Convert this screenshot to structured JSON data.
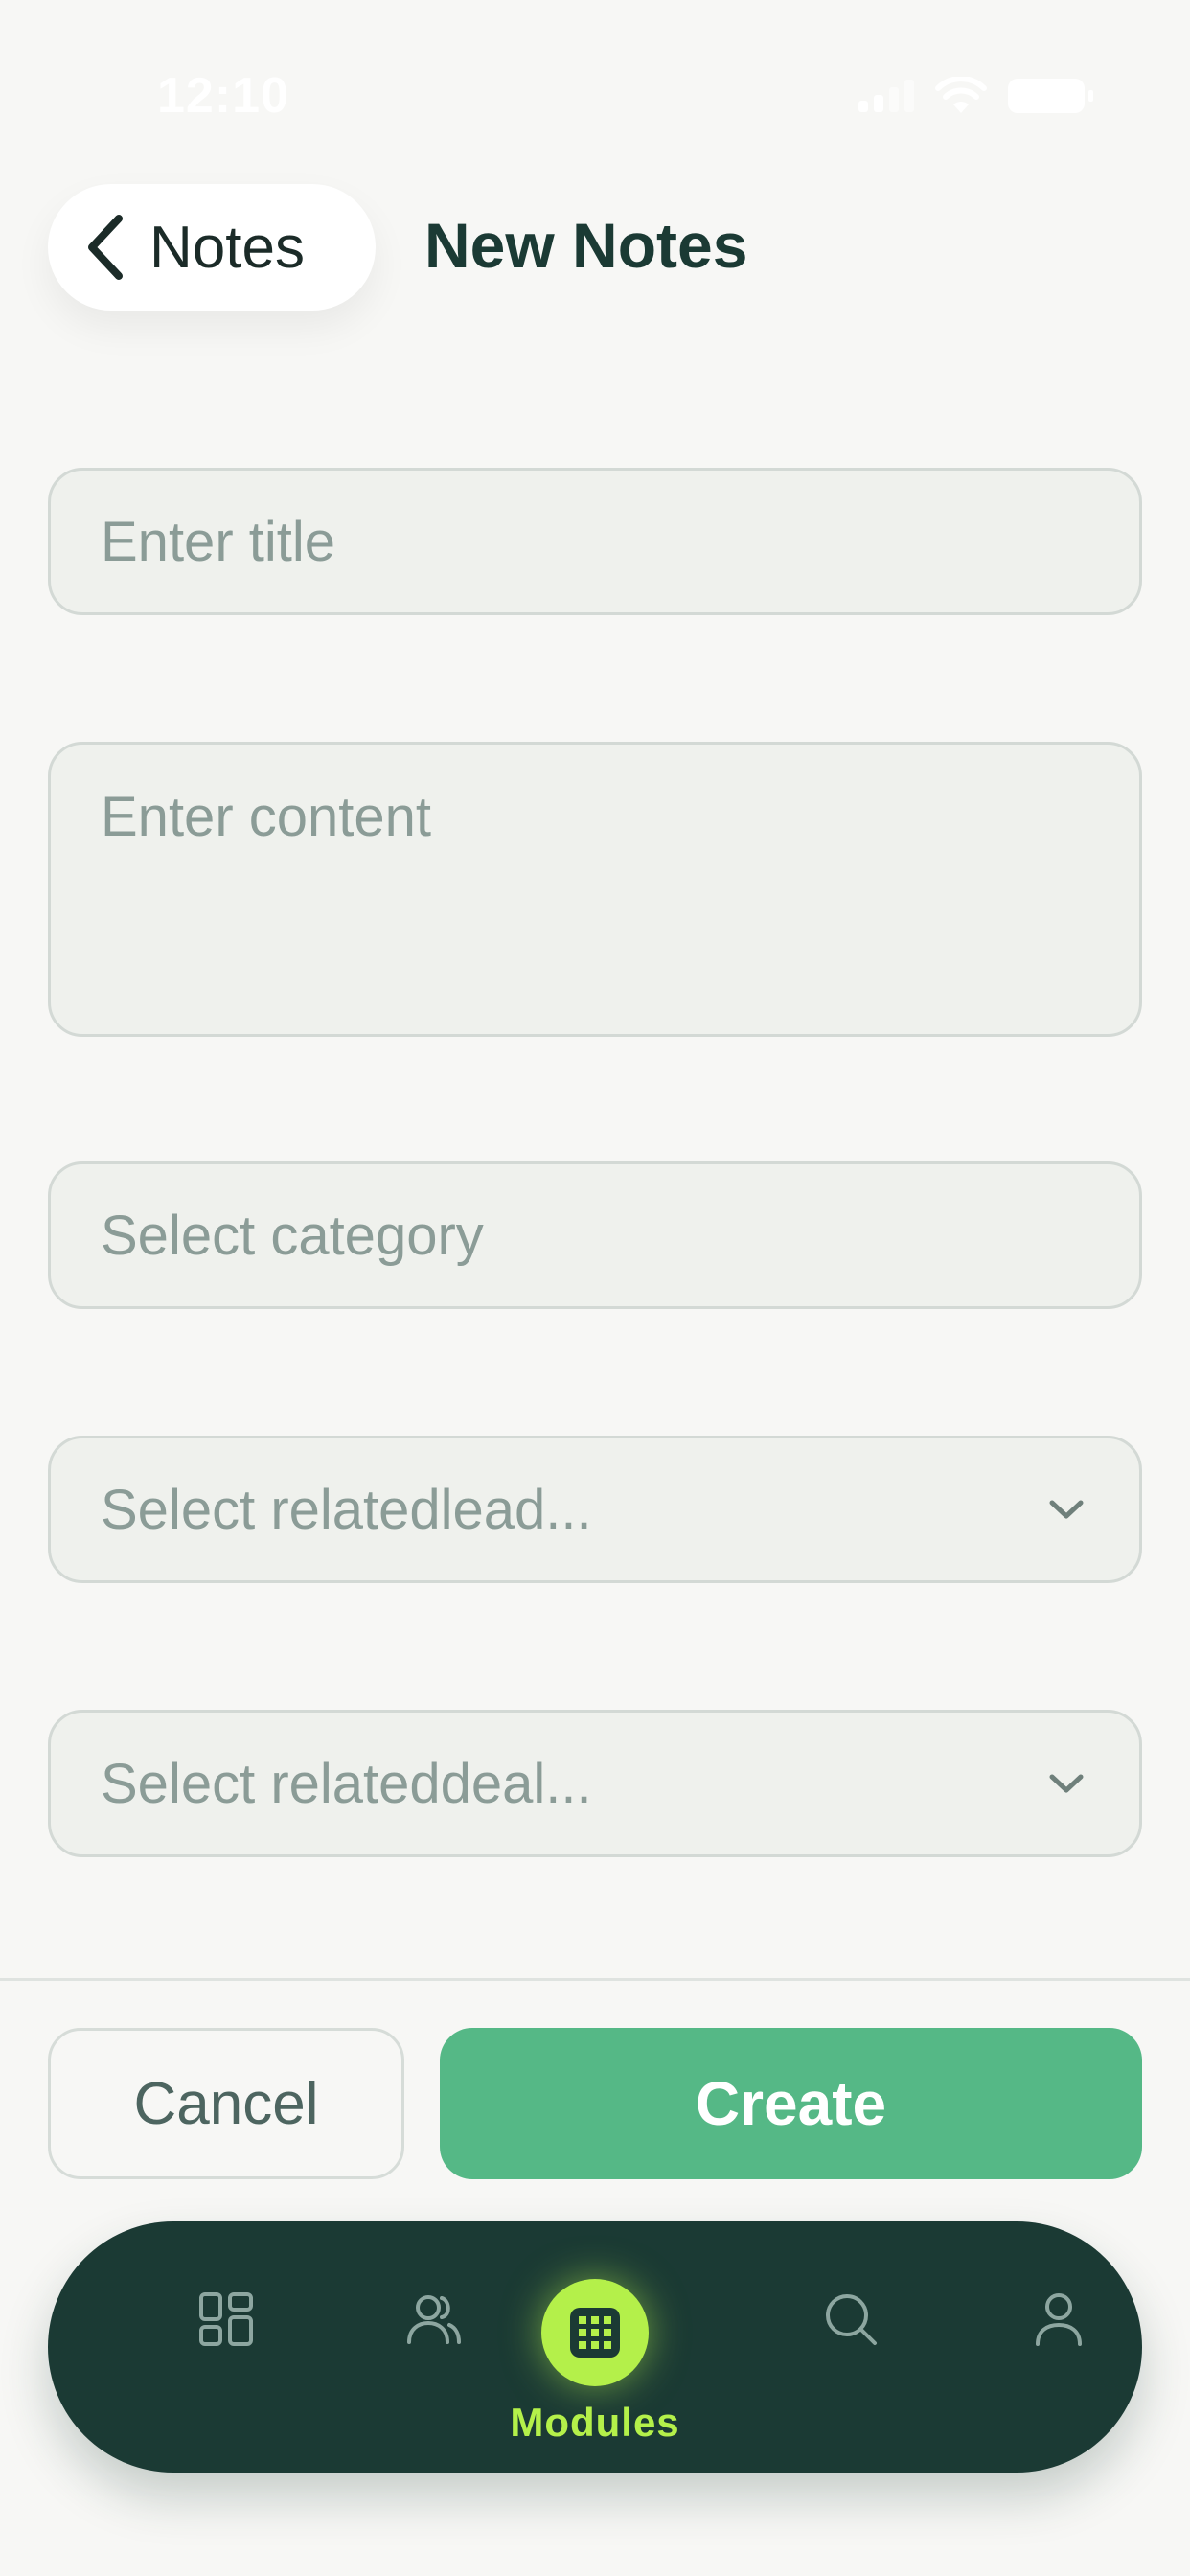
{
  "status_bar": {
    "time": "12:10"
  },
  "header": {
    "back_label": "Notes",
    "title": "New Notes"
  },
  "form": {
    "title_placeholder": "Enter title",
    "content_placeholder": "Enter content",
    "category_placeholder": "Select category",
    "related_lead_placeholder": "Select relatedlead...",
    "related_deal_placeholder": "Select relateddeal..."
  },
  "actions": {
    "cancel_label": "Cancel",
    "create_label": "Create"
  },
  "tab_bar": {
    "active_label": "Modules",
    "tabs": [
      {
        "icon": "dashboard-icon"
      },
      {
        "icon": "users-icon"
      },
      {
        "icon": "grid-icon",
        "label": "Modules"
      },
      {
        "icon": "search-icon"
      },
      {
        "icon": "user-icon"
      }
    ]
  },
  "colors": {
    "primary": "#1b3a34",
    "accent": "#55b886",
    "highlight": "#b4f04a",
    "background": "#f7f7f5"
  }
}
